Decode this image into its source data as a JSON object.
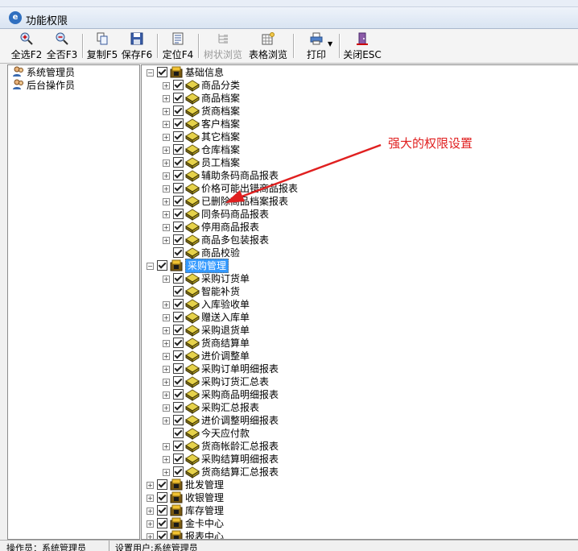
{
  "window": {
    "title": "功能权限"
  },
  "toolbar": {
    "select_all": "全选F2",
    "select_none": "全否F3",
    "copy": "复制F5",
    "save": "保存F6",
    "locate": "定位F4",
    "tree_browse": "树状浏览",
    "table_browse": "表格浏览",
    "print": "打印",
    "close": "关闭ESC"
  },
  "users": [
    {
      "label": "系统管理员"
    },
    {
      "label": "后台操作员"
    }
  ],
  "tree": {
    "basic": {
      "label": "基础信息",
      "items": [
        "商品分类",
        "商品档案",
        "货商档案",
        "客户档案",
        "其它档案",
        "仓库档案",
        "员工档案",
        "辅助条码商品报表",
        "价格可能出错商品报表",
        "已删除商品档案报表",
        "同条码商品报表",
        "停用商品报表",
        "商品多包装报表",
        "商品校验"
      ]
    },
    "purchase": {
      "label": "采购管理",
      "items": [
        "采购订货单",
        "智能补货",
        "入库验收单",
        "赠送入库单",
        "采购退货单",
        "货商结算单",
        "进价调整单",
        "采购订单明细报表",
        "采购订货汇总表",
        "采购商品明细报表",
        "采购汇总报表",
        "进价调整明细报表",
        "今天应付款",
        "货商帐龄汇总报表",
        "采购结算明细报表",
        "货商结算汇总报表"
      ]
    },
    "others": [
      "批发管理",
      "收银管理",
      "库存管理",
      "金卡中心",
      "报表中心"
    ]
  },
  "annotation": {
    "text": "强大的权限设置",
    "color": "#e02020"
  },
  "status": {
    "operator": "操作员：系统管理员",
    "set_user": "设置用户:系统管理员"
  }
}
